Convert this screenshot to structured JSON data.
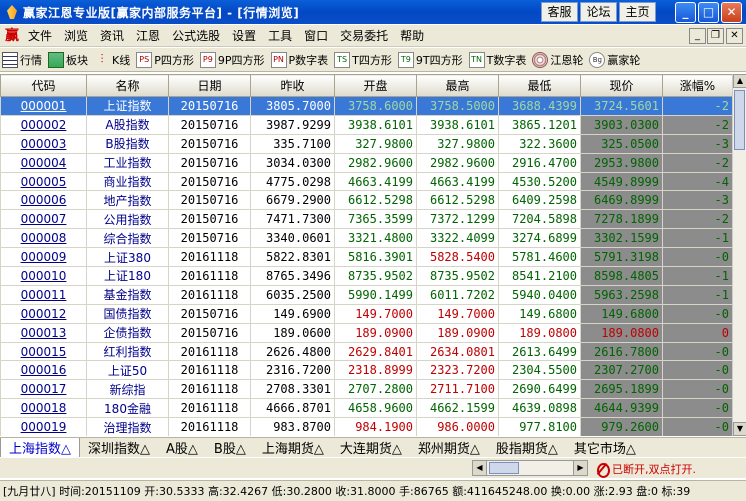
{
  "window": {
    "title": "赢家江恩专业版[赢家内部服务平台] - [行情浏览]",
    "buttons": [
      "客服",
      "论坛",
      "主页"
    ]
  },
  "menu": {
    "logo": "赢",
    "items": [
      "文件",
      "浏览",
      "资讯",
      "江恩",
      "公式选股",
      "设置",
      "工具",
      "窗口",
      "交易委托",
      "帮助"
    ]
  },
  "toolbar": {
    "items": [
      {
        "label": "行情",
        "icon": "list-icon"
      },
      {
        "label": "板块",
        "icon": "block-icon"
      },
      {
        "label": "K线",
        "icon": "kline-icon"
      },
      {
        "label": "P四方形",
        "icon": "ps-icon",
        "icon_text": "PS"
      },
      {
        "label": "9P四方形",
        "icon": "p9-icon",
        "icon_text": "P9"
      },
      {
        "label": "P数字表",
        "icon": "pn-icon",
        "icon_text": "PN"
      },
      {
        "label": "T四方形",
        "icon": "ts-icon",
        "icon_text": "TS"
      },
      {
        "label": "9T四方形",
        "icon": "t9-icon",
        "icon_text": "T9"
      },
      {
        "label": "T数字表",
        "icon": "tn-icon",
        "icon_text": "TN"
      },
      {
        "label": "江恩轮",
        "icon": "gann-wheel-icon"
      },
      {
        "label": "赢家轮",
        "icon": "winner-wheel-icon",
        "icon_text": "Bg"
      }
    ]
  },
  "table": {
    "headers": [
      "代码",
      "名称",
      "日期",
      "昨收",
      "开盘",
      "最高",
      "最低",
      "现价",
      "涨幅%"
    ],
    "rows": [
      [
        "000001",
        "上证指数",
        "20150716",
        "3805.7000",
        "3758.6000",
        "3758.5000",
        "3688.4399",
        "3724.5601",
        "-2"
      ],
      [
        "000002",
        "A股指数",
        "20150716",
        "3987.9299",
        "3938.6101",
        "3938.6101",
        "3865.1201",
        "3903.0300",
        "-2"
      ],
      [
        "000003",
        "B股指数",
        "20150716",
        "335.7100",
        "327.9800",
        "327.9800",
        "322.3600",
        "325.0500",
        "-3"
      ],
      [
        "000004",
        "工业指数",
        "20150716",
        "3034.0300",
        "2982.9600",
        "2982.9600",
        "2916.4700",
        "2953.9800",
        "-2"
      ],
      [
        "000005",
        "商业指数",
        "20150716",
        "4775.0298",
        "4663.4199",
        "4663.4199",
        "4530.5200",
        "4549.8999",
        "-4"
      ],
      [
        "000006",
        "地产指数",
        "20150716",
        "6679.2900",
        "6612.5298",
        "6612.5298",
        "6409.2598",
        "6469.8999",
        "-3"
      ],
      [
        "000007",
        "公用指数",
        "20150716",
        "7471.7300",
        "7365.3599",
        "7372.1299",
        "7204.5898",
        "7278.1899",
        "-2"
      ],
      [
        "000008",
        "综合指数",
        "20150716",
        "3340.0601",
        "3321.4800",
        "3322.4099",
        "3274.6899",
        "3302.1599",
        "-1"
      ],
      [
        "000009",
        "上证380",
        "20161118",
        "5822.8301",
        "5816.3901",
        "5828.5400",
        "5781.4600",
        "5791.3198",
        "-0"
      ],
      [
        "000010",
        "上证180",
        "20161118",
        "8765.3496",
        "8735.9502",
        "8735.9502",
        "8541.2100",
        "8598.4805",
        "-1"
      ],
      [
        "000011",
        "基金指数",
        "20161118",
        "6035.2500",
        "5990.1499",
        "6011.7202",
        "5940.0400",
        "5963.2598",
        "-1"
      ],
      [
        "000012",
        "国债指数",
        "20150716",
        "149.6900",
        "149.7000",
        "149.7000",
        "149.6800",
        "149.6800",
        "-0"
      ],
      [
        "000013",
        "企债指数",
        "20150716",
        "189.0600",
        "189.0900",
        "189.0900",
        "189.0800",
        "189.0800",
        "0"
      ],
      [
        "000015",
        "红利指数",
        "20161118",
        "2626.4800",
        "2629.8401",
        "2634.0801",
        "2613.6499",
        "2616.7800",
        "-0"
      ],
      [
        "000016",
        "上证50",
        "20161118",
        "2316.7200",
        "2318.8999",
        "2323.7200",
        "2304.5500",
        "2307.2700",
        "-0"
      ],
      [
        "000017",
        "新综指",
        "20161118",
        "2708.3301",
        "2707.2800",
        "2711.7100",
        "2690.6499",
        "2695.1899",
        "-0"
      ],
      [
        "000018",
        "180金融",
        "20161118",
        "4666.8701",
        "4658.9600",
        "4662.1599",
        "4639.0898",
        "4644.9399",
        "-0"
      ],
      [
        "000019",
        "治理指数",
        "20161118",
        "983.8700",
        "984.1900",
        "986.0000",
        "977.8100",
        "979.2600",
        "-0"
      ]
    ]
  },
  "tabs": [
    "上海指数△",
    "深圳指数△",
    "A股△",
    "B股△",
    "上海期货△",
    "大连期货△",
    "郑州期货△",
    "股指期货△",
    "其它市场△"
  ],
  "network_status": "已断开,双点打开.",
  "status_bar": "[九月廿八] 时间:20151109 开:30.5333 高:32.4267 低:30.2800 收:31.8000 手:86765 额:411645248.00 换:0.00 涨:2.93 盘:0 标:39",
  "colors": {
    "title_bar": "#0a5fd8",
    "row_select": "#3a78d8",
    "up": "#c00000",
    "down": "#006400",
    "code_text": "#00008b"
  }
}
